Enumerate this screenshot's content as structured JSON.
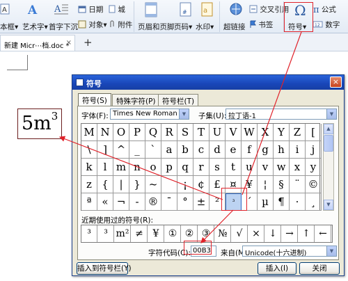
{
  "ribbon": {
    "text_box": "本框",
    "art_text": "艺术字",
    "drop_cap": "首字下沉",
    "date": "日期",
    "city": "城",
    "object": "对象",
    "attachment": "附件",
    "header_footer": "页眉和页脚",
    "page_number": "页码",
    "watermark": "水印",
    "hyperlink": "超链接",
    "cross_reference": "交叉引用",
    "bookmark": "书签",
    "symbol": "符号",
    "formula": "公式",
    "number": "数字"
  },
  "tabbar": {
    "doc_tab": "新建 Micr⋯档.doc *",
    "close_glyph": "×",
    "new_tab_glyph": "+"
  },
  "document": {
    "sample_base": "5m",
    "sample_sup": "3"
  },
  "dialog": {
    "title": "符号",
    "close_glyph": "×",
    "tabs": [
      "符号(S)",
      "特殊字符(P)",
      "符号栏(T)"
    ],
    "font_label": "字体(F):",
    "font_value": "Times New Roman",
    "subset_label": "子集(U):",
    "subset_value": "拉丁语-1",
    "grid": [
      [
        "M",
        "N",
        "O",
        "P",
        "Q",
        "R",
        "S",
        "T",
        "U",
        "V",
        "W",
        "X",
        "Y",
        "Z",
        "["
      ],
      [
        "\\",
        "]",
        "^",
        "_",
        "`",
        "a",
        "b",
        "c",
        "d",
        "e",
        "f",
        "g",
        "h",
        "i",
        "j"
      ],
      [
        "k",
        "l",
        "m",
        "n",
        "o",
        "p",
        "q",
        "r",
        "s",
        "t",
        "u",
        "v",
        "w",
        "x",
        "y"
      ],
      [
        "z",
        "{",
        "|",
        "}",
        "~",
        "",
        "¡",
        "¢",
        "£",
        "¤",
        "¥",
        "¦",
        "§",
        "¨",
        "©"
      ],
      [
        "ª",
        "«",
        "¬",
        "-",
        "®",
        "¯",
        "°",
        "±",
        "²",
        "³",
        "´",
        "µ",
        "¶",
        "·",
        "¸"
      ]
    ],
    "selected_symbol": "³",
    "recent_label": "近期使用过的符号(R):",
    "recent": [
      "³",
      "³",
      "m²",
      "≠",
      "¥",
      "①",
      "②",
      "③",
      "№",
      "√",
      "×",
      "↓",
      "→",
      "↑",
      "←"
    ],
    "code_label": "字符代码(C):",
    "code_value": "00B3",
    "from_label": "来自(M):",
    "from_value": "Unicode(十六进制)",
    "insert_to_bar": "插入到符号栏(Y)",
    "insert": "插入(I)",
    "close": "关闭"
  },
  "colors": {
    "annotation": "#e0222a",
    "title_bar": "#1946b8",
    "dialog_bg": "#ece9d8"
  }
}
